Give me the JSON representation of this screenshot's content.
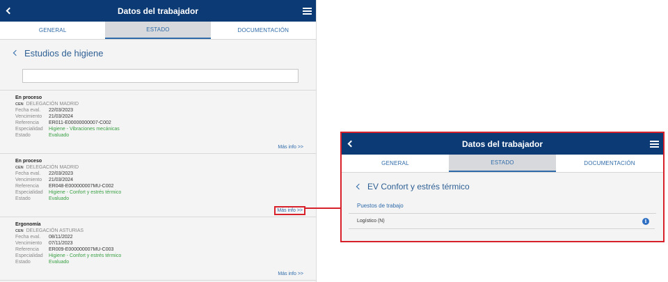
{
  "left": {
    "header": {
      "title": "Datos del trabajador"
    },
    "tabs": [
      {
        "label": "GENERAL"
      },
      {
        "label": "ESTADO"
      },
      {
        "label": "DOCUMENTACIÓN"
      }
    ],
    "section_title": "Estudios de higiene",
    "search": {
      "value": ""
    },
    "field_labels": {
      "fecha": "Fecha eval.",
      "vencimiento": "Vencimiento",
      "referencia": "Referencia",
      "especialidad": "Especialidad",
      "estado": "Estado"
    },
    "cards": [
      {
        "title": "En proceso",
        "org_code": "CEN",
        "org_name": "DELEGACIÓN MADRID",
        "fecha": "22/03/2023",
        "vencimiento": "21/03/2024",
        "referencia": "ER011-E00000000007-C002",
        "especialidad": "Higiene - Vibraciones mecánicas",
        "estado": "Evaluado",
        "more": "Más info >>"
      },
      {
        "title": "En proceso",
        "org_code": "CEN",
        "org_name": "DELEGACIÓN MADRID",
        "fecha": "22/03/2023",
        "vencimiento": "21/03/2024",
        "referencia": "ER048-E000000007MU-C002",
        "especialidad": "Higiene - Confort y estrés térmico",
        "estado": "Evaluado",
        "more": "Más info >>"
      },
      {
        "title": "Ergonomía",
        "org_code": "CEN",
        "org_name": "DELEGACIÓN ASTURIAS",
        "fecha": "08/11/2022",
        "vencimiento": "07/11/2023",
        "referencia": "ER009-E000000007MU-C003",
        "especialidad": "Higiene - Confort y estrés térmico",
        "estado": "Evaluado",
        "more": "Más info >>"
      }
    ]
  },
  "right": {
    "header": {
      "title": "Datos del trabajador"
    },
    "tabs": [
      {
        "label": "GENERAL"
      },
      {
        "label": "ESTADO"
      },
      {
        "label": "DOCUMENTACIÓN"
      }
    ],
    "section_title": "EV Confort y estrés térmico",
    "subheading": "Puestos de trabajo",
    "items": [
      {
        "label": "Logístico (N)"
      }
    ]
  },
  "colors": {
    "header_bg": "#0b3a75",
    "accent": "#2e6aa8",
    "highlight": "#d8202a",
    "status_green": "#3aa043"
  },
  "icons": [
    "back-chevron-icon",
    "menu-icon",
    "info-icon"
  ]
}
